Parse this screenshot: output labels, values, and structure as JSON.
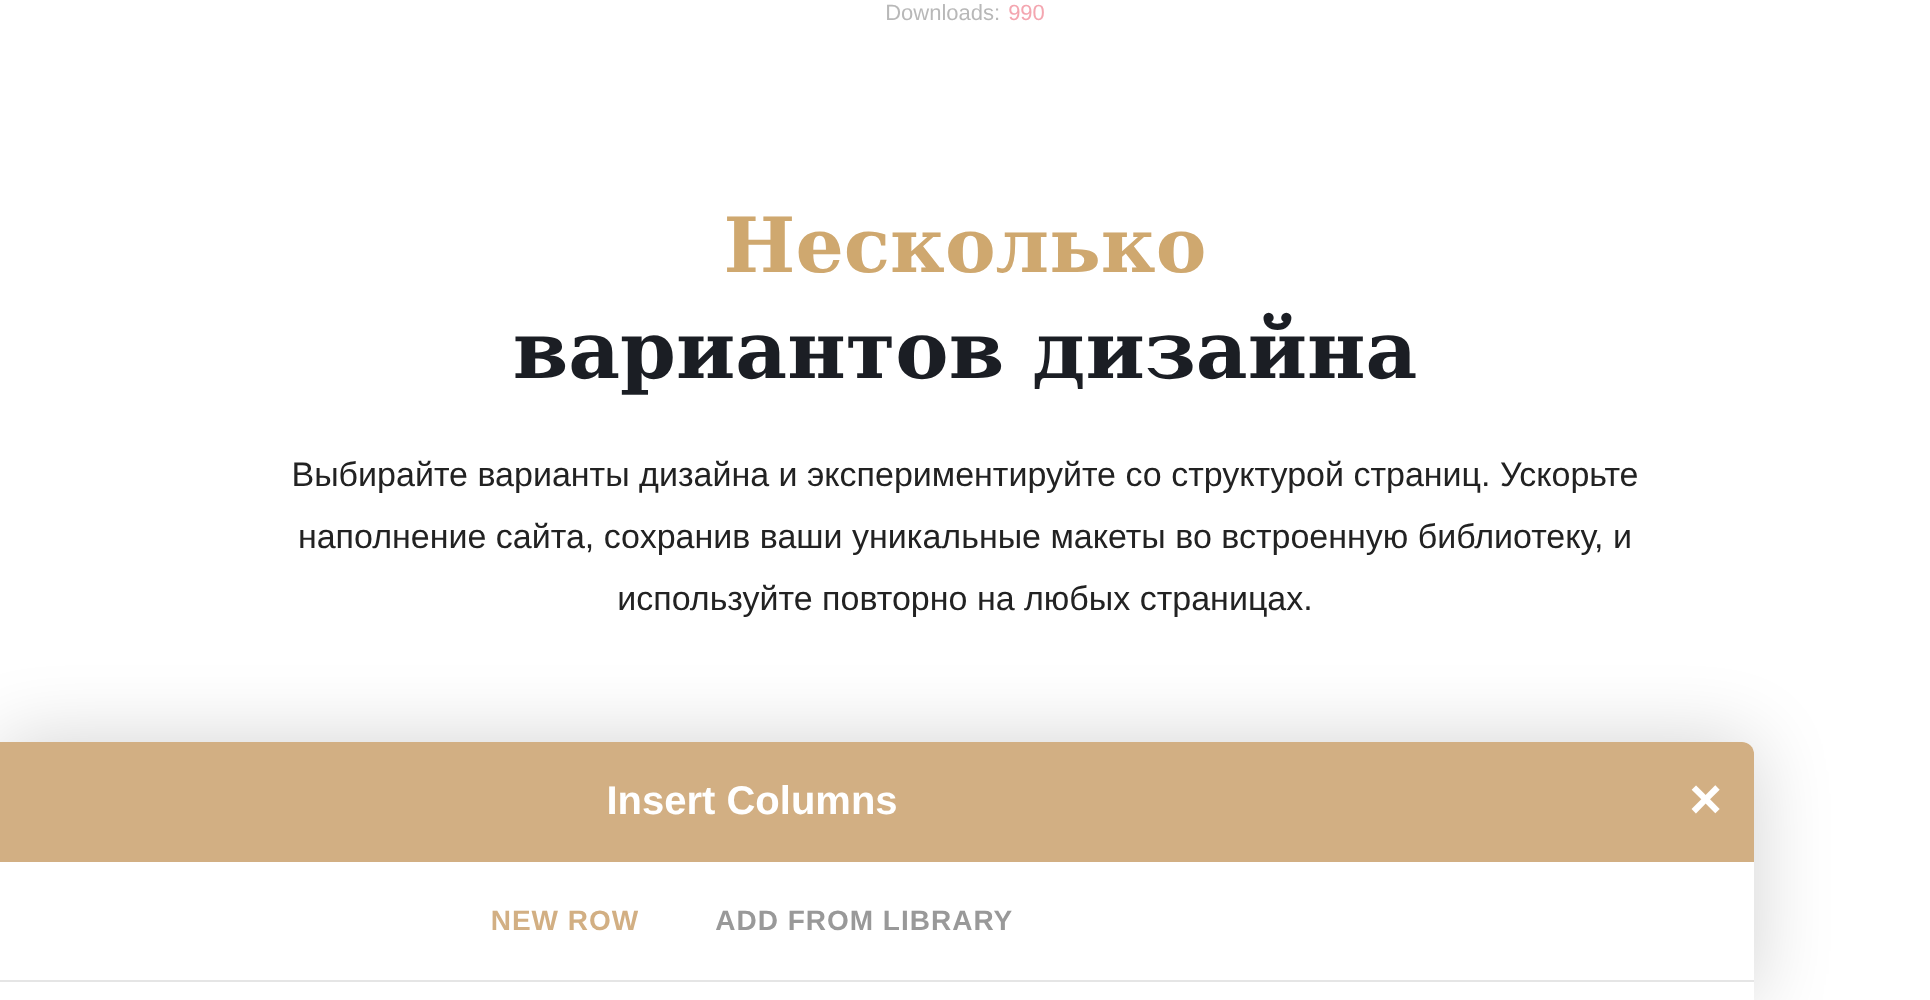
{
  "downloads": {
    "label": "Downloads:",
    "count": "990"
  },
  "heading": {
    "accent": "Несколько",
    "main": "вариантов дизайна"
  },
  "description": "Выбирайте варианты дизайна и экспериментируйте со структурой страниц. Ускорьте наполнение сайта, сохранив ваши уникальные макеты во встроенную библиотеку, и используйте повторно на любых страницах.",
  "modal": {
    "title": "Insert Columns",
    "close": "×",
    "tabs": [
      {
        "label": "NEW ROW",
        "selected": true
      },
      {
        "label": "ADD FROM LIBRARY",
        "selected": false
      }
    ]
  }
}
